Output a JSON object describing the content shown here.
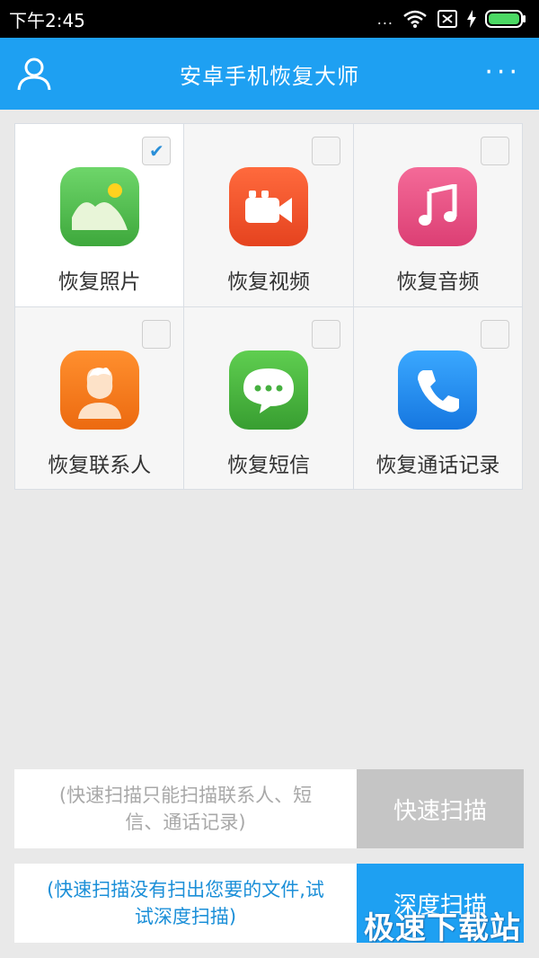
{
  "status_bar": {
    "time": "下午2:45",
    "dots": "..."
  },
  "app_bar": {
    "title": "安卓手机恢复大师",
    "more_label": "···"
  },
  "items": [
    {
      "label": "恢复照片",
      "checked": true,
      "check_mark": "✔",
      "icon": "photo-icon",
      "color": "#4cbf4c"
    },
    {
      "label": "恢复视频",
      "checked": false,
      "check_mark": "",
      "icon": "video-icon",
      "color": "#f0542c"
    },
    {
      "label": "恢复音频",
      "checked": false,
      "check_mark": "",
      "icon": "music-icon",
      "color": "#e84f82"
    },
    {
      "label": "恢复联系人",
      "checked": false,
      "check_mark": "",
      "icon": "contact-icon",
      "color": "#f27a1a"
    },
    {
      "label": "恢复短信",
      "checked": false,
      "check_mark": "",
      "icon": "message-icon",
      "color": "#46b040"
    },
    {
      "label": "恢复通话记录",
      "checked": false,
      "check_mark": "",
      "icon": "phone-icon",
      "color": "#1f8ff0"
    }
  ],
  "quick_scan": {
    "description": "(快速扫描只能扫描联系人、短信、通话记录)",
    "button": "快速扫描"
  },
  "deep_scan": {
    "description": "(快速扫描没有扫出您要的文件,试试深度扫描)",
    "button": "深度扫描"
  },
  "watermark": "极速下载站"
}
